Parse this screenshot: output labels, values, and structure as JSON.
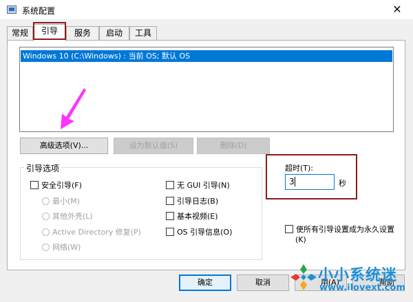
{
  "window": {
    "title": "系统配置",
    "close_symbol": "✕"
  },
  "tabs": [
    {
      "label": "常规"
    },
    {
      "label": "引导"
    },
    {
      "label": "服务"
    },
    {
      "label": "启动"
    },
    {
      "label": "工具"
    }
  ],
  "boot": {
    "os_entries": [
      "Windows 10 (C:\\Windows) : 当前 OS; 默认 OS"
    ],
    "advanced_options_label": "高级选项(V)...",
    "set_default_label": "设为默认值(S)",
    "delete_label": "删除(D)"
  },
  "boot_options": {
    "group_title": "引导选项",
    "safe_boot": "安全引导(F)",
    "minimal": "最小(M)",
    "alternate_shell": "其他外壳(L)",
    "active_directory_repair": "Active Directory 修复(P)",
    "network": "网络(W)",
    "no_gui_boot": "无 GUI 引导(N)",
    "boot_log": "引导日志(B)",
    "base_video": "基本视频(E)",
    "os_boot_info": "OS 引导信息(O)"
  },
  "timeout": {
    "label": "超时(T):",
    "value": "3",
    "unit": "秒"
  },
  "permanent": {
    "label_line1": "使所有引导设置成为永久设置",
    "label_line2": "(K)"
  },
  "footer": {
    "ok_label": "确定",
    "cancel_label": "取消",
    "apply_label": "用(A)",
    "help_label": "帮助"
  },
  "watermark": {
    "name": "小小系统迷",
    "url": "www.ilovext.com"
  },
  "colors": {
    "selection": "#0078d7",
    "highlight_box": "#8c1a1a",
    "arrow": "#ff33ff",
    "watermark": "#1e90d8"
  }
}
